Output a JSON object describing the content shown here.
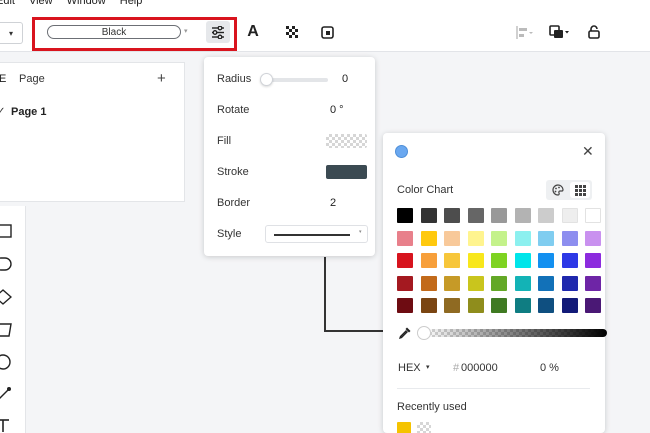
{
  "menubar": {
    "items": [
      "Edit",
      "View",
      "Window",
      "Help"
    ]
  },
  "toolbar": {
    "left_caret": "▾",
    "stroke_color_value": "Black",
    "stroke_caret": "▾",
    "text_icon_glyph": "A",
    "icons": [
      "chevron-down-icon",
      "style-settings-icon",
      "text-color-icon",
      "transparency-icon",
      "shadow-icon",
      "align-icon",
      "arrange-icon",
      "lock-icon"
    ]
  },
  "page_panel": {
    "menu_glyph": "E",
    "title": "Page",
    "add_glyph": "+",
    "check_glyph": "✓",
    "page1": "Page 1"
  },
  "shapes": {
    "items": [
      "rectangle-shape-icon",
      "rounded-shape-icon",
      "diamond-shape-icon",
      "parallelogram-shape-icon",
      "circle-shape-icon",
      "line-shape-icon",
      "text-shape-icon"
    ]
  },
  "style_panel": {
    "radius_label": "Radius",
    "radius_value": "0",
    "radius_level": 0,
    "rotate_label": "Rotate",
    "rotate_value": "0 °",
    "fill_label": "Fill",
    "fill_value": "transparent",
    "stroke_label": "Stroke",
    "stroke_color": "#3b4a52",
    "border_label": "Border",
    "border_value": "2",
    "style_label": "Style",
    "style_value": "solid",
    "style_caret": "▾"
  },
  "color_panel": {
    "current_color": "#6aa8f0",
    "close_glyph": "✕",
    "title": "Color Chart",
    "modes": [
      "palette-mode-icon",
      "grid-mode-icon"
    ],
    "selected_mode": "grid",
    "swatches": [
      [
        "#000000",
        "#333333",
        "#4d4d4d",
        "#666666",
        "#999999",
        "#b3b3b3",
        "#cccccc",
        "#eeeeee",
        "#ffffff"
      ],
      [
        "#e8808b",
        "#ffc90e",
        "#f8c99a",
        "#fff48f",
        "#c4f28b",
        "#8cf0ef",
        "#80cdf0",
        "#8d8eef",
        "#c991ef"
      ],
      [
        "#d7141e",
        "#f79f3a",
        "#f7c63a",
        "#f8e71c",
        "#7ed321",
        "#00e5ea",
        "#1390f0",
        "#2d38e6",
        "#8c2bde"
      ],
      [
        "#a41920",
        "#c26a1a",
        "#c69a27",
        "#c9c51d",
        "#63a826",
        "#13b3b6",
        "#1271b8",
        "#1f28ad",
        "#6e25a6"
      ],
      [
        "#6e0c12",
        "#7a4512",
        "#8f6a22",
        "#8f8d1c",
        "#3f7a22",
        "#0f7d82",
        "#0f4f80",
        "#121a78",
        "#4a1875"
      ]
    ],
    "alpha": 0,
    "eyedropper_icon": "eyedropper-icon",
    "format_label": "HEX",
    "format_caret": "▾",
    "hash_glyph": "#",
    "hex_value": "000000",
    "opacity_value": "0 %",
    "recent_label": "Recently used",
    "recent_colors": [
      "#f5c300",
      "transparent"
    ]
  }
}
